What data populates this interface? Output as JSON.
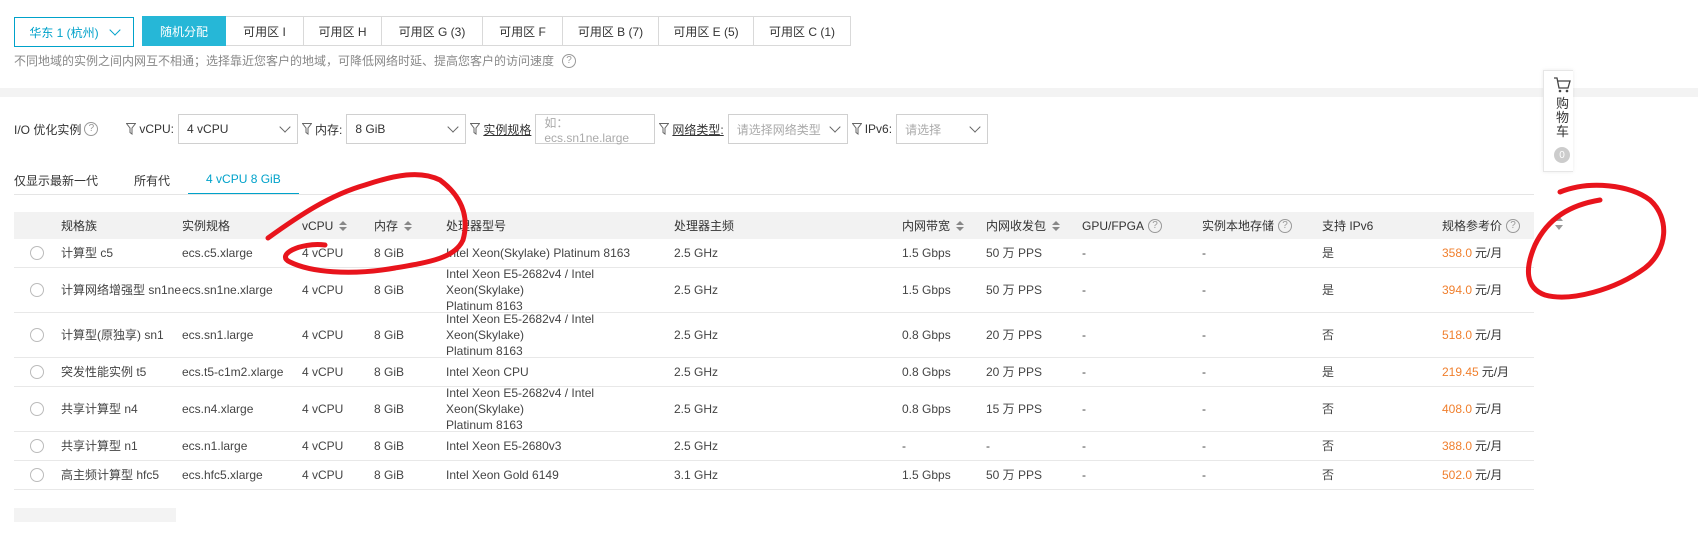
{
  "region": {
    "label": "华东 1 (杭州)"
  },
  "zones": [
    {
      "label": "随机分配",
      "active": true
    },
    {
      "label": "可用区 I"
    },
    {
      "label": "可用区 H"
    },
    {
      "label": "可用区 G (3)"
    },
    {
      "label": "可用区 F"
    },
    {
      "label": "可用区 B (7)"
    },
    {
      "label": "可用区 E (5)"
    },
    {
      "label": "可用区 C (1)"
    }
  ],
  "zone_hint": "不同地域的实例之间内网互不相通；选择靠近您客户的地域，可降低网络时延、提高您客户的访问速度",
  "filters": {
    "io_label": "I/O 优化实例",
    "vcpu_label": "vCPU:",
    "vcpu_value": "4 vCPU",
    "mem_label": "内存:",
    "mem_value": "8 GiB",
    "spec_label": "实例规格",
    "spec_placeholder": "如：ecs.sn1ne.large",
    "net_label": "网络类型:",
    "net_placeholder": "请选择网络类型",
    "ipv6_label": "IPv6:",
    "ipv6_placeholder": "请选择"
  },
  "tabs": [
    "仅显示最新一代",
    "所有代",
    "4 vCPU 8 GiB"
  ],
  "table": {
    "headers": [
      "规格族",
      "实例规格",
      "vCPU",
      "内存",
      "处理器型号",
      "处理器主频",
      "内网带宽",
      "内网收发包",
      "GPU/FPGA",
      "实例本地存储",
      "支持 IPv6",
      "规格参考价"
    ],
    "price_unit": "元/月",
    "rows": [
      {
        "family": "计算型 c5",
        "spec": "ecs.c5.xlarge",
        "vcpu": "4 vCPU",
        "mem": "8 GiB",
        "cpu_line1": "Intel Xeon(Skylake) Platinum 8163",
        "cpu_line2": "",
        "freq": "2.5 GHz",
        "bw": "1.5 Gbps",
        "pps": "50 万 PPS",
        "gpu": "-",
        "storage": "-",
        "ipv6": "是",
        "price": "358.0"
      },
      {
        "family": "计算网络增强型 sn1ne",
        "spec": "ecs.sn1ne.xlarge",
        "vcpu": "4 vCPU",
        "mem": "8 GiB",
        "cpu_line1": "Intel Xeon E5-2682v4 / Intel Xeon(Skylake)",
        "cpu_line2": "Platinum 8163",
        "freq": "2.5 GHz",
        "bw": "1.5 Gbps",
        "pps": "50 万 PPS",
        "gpu": "-",
        "storage": "-",
        "ipv6": "是",
        "price": "394.0"
      },
      {
        "family": "计算型(原独享) sn1",
        "spec": "ecs.sn1.large",
        "vcpu": "4 vCPU",
        "mem": "8 GiB",
        "cpu_line1": "Intel Xeon E5-2682v4 / Intel Xeon(Skylake)",
        "cpu_line2": "Platinum 8163",
        "freq": "2.5 GHz",
        "bw": "0.8 Gbps",
        "pps": "20 万 PPS",
        "gpu": "-",
        "storage": "-",
        "ipv6": "否",
        "price": "518.0"
      },
      {
        "family": "突发性能实例 t5",
        "spec": "ecs.t5-c1m2.xlarge",
        "vcpu": "4 vCPU",
        "mem": "8 GiB",
        "cpu_line1": "Intel Xeon CPU",
        "cpu_line2": "",
        "freq": "2.5 GHz",
        "bw": "0.8 Gbps",
        "pps": "20 万 PPS",
        "gpu": "-",
        "storage": "-",
        "ipv6": "是",
        "price": "219.45"
      },
      {
        "family": "共享计算型 n4",
        "spec": "ecs.n4.xlarge",
        "vcpu": "4 vCPU",
        "mem": "8 GiB",
        "cpu_line1": "Intel Xeon E5-2682v4 / Intel Xeon(Skylake)",
        "cpu_line2": "Platinum 8163",
        "freq": "2.5 GHz",
        "bw": "0.8 Gbps",
        "pps": "15 万 PPS",
        "gpu": "-",
        "storage": "-",
        "ipv6": "否",
        "price": "408.0"
      },
      {
        "family": "共享计算型 n1",
        "spec": "ecs.n1.large",
        "vcpu": "4 vCPU",
        "mem": "8 GiB",
        "cpu_line1": "Intel Xeon E5-2680v3",
        "cpu_line2": "",
        "freq": "2.5 GHz",
        "bw": "-",
        "pps": "-",
        "gpu": "-",
        "storage": "-",
        "ipv6": "否",
        "price": "388.0"
      },
      {
        "family": "高主频计算型 hfc5",
        "spec": "ecs.hfc5.xlarge",
        "vcpu": "4 vCPU",
        "mem": "8 GiB",
        "cpu_line1": "Intel Xeon Gold 6149",
        "cpu_line2": "",
        "freq": "3.1 GHz",
        "bw": "1.5 Gbps",
        "pps": "50 万 PPS",
        "gpu": "-",
        "storage": "-",
        "ipv6": "否",
        "price": "502.0"
      }
    ]
  },
  "cart": {
    "label": "购物车",
    "count": "0"
  },
  "colors": {
    "accent": "#00a2ca",
    "active_zone": "#26b7d7",
    "price": "#f07f2d",
    "annotation": "#e8141c"
  }
}
